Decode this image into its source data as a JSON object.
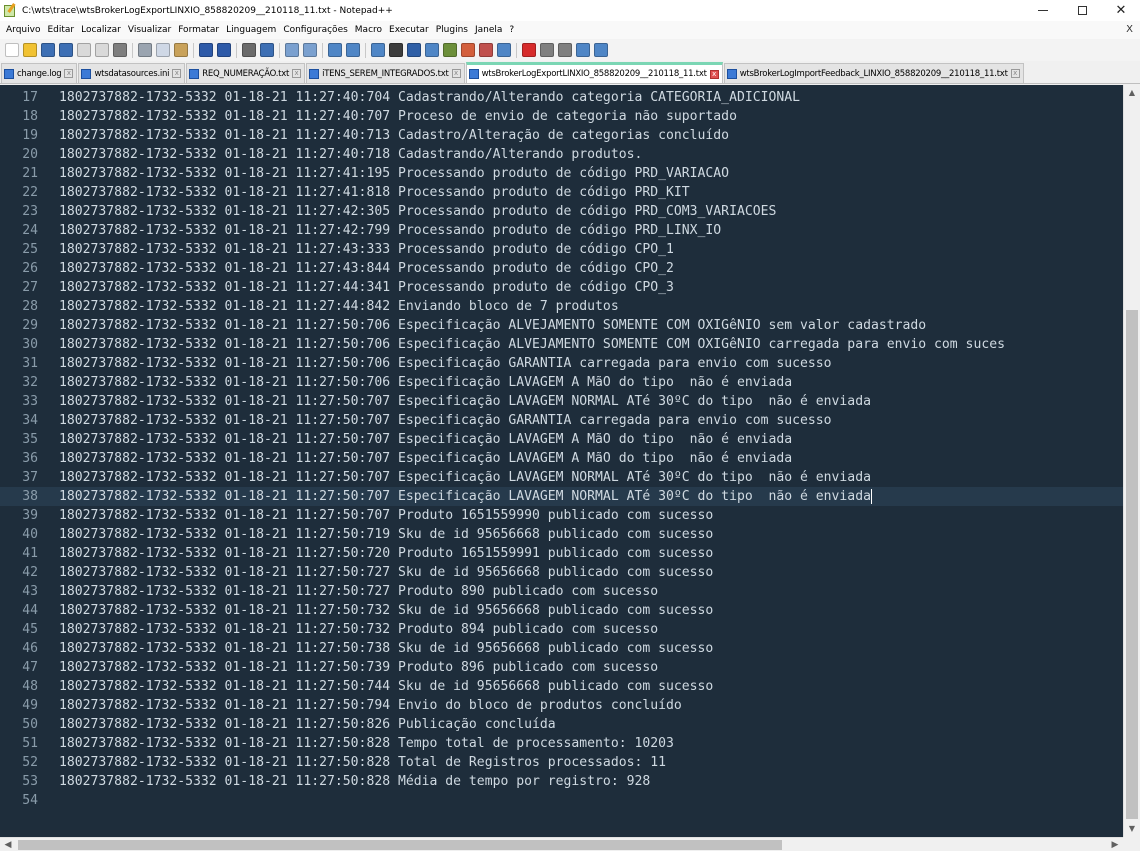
{
  "window": {
    "title": "C:\\wts\\trace\\wtsBrokerLogExportLINXIO_858820209__210118_11.txt - Notepad++",
    "controls": {
      "minimize": "—",
      "maximize": "□",
      "close": "✕"
    }
  },
  "menu": {
    "items": [
      "Arquivo",
      "Editar",
      "Localizar",
      "Visualizar",
      "Formatar",
      "Linguagem",
      "Configurações",
      "Macro",
      "Executar",
      "Plugins",
      "Janela",
      "?"
    ],
    "close_x": "X"
  },
  "toolbar": {
    "icons": [
      {
        "name": "new-file-icon",
        "color": "#ffffff"
      },
      {
        "name": "open-file-icon",
        "color": "#f1c232"
      },
      {
        "name": "save-icon",
        "color": "#3d6fb4"
      },
      {
        "name": "save-all-icon",
        "color": "#3d6fb4"
      },
      {
        "name": "close-file-icon",
        "color": "#d9d9d9"
      },
      {
        "name": "close-all-icon",
        "color": "#d9d9d9"
      },
      {
        "name": "print-icon",
        "color": "#7f7f7f"
      },
      {
        "sep": true
      },
      {
        "name": "cut-icon",
        "color": "#9aa4b0"
      },
      {
        "name": "copy-icon",
        "color": "#cfd8e6"
      },
      {
        "name": "paste-icon",
        "color": "#c9a25a"
      },
      {
        "sep": true
      },
      {
        "name": "undo-icon",
        "color": "#2e5aa8"
      },
      {
        "name": "redo-icon",
        "color": "#2e5aa8"
      },
      {
        "sep": true
      },
      {
        "name": "find-icon",
        "color": "#6a6a6a"
      },
      {
        "name": "replace-icon",
        "color": "#3d6fb4"
      },
      {
        "sep": true
      },
      {
        "name": "zoom-in-icon",
        "color": "#7aa0cf"
      },
      {
        "name": "zoom-out-icon",
        "color": "#7aa0cf"
      },
      {
        "sep": true
      },
      {
        "name": "sync-vertical-icon",
        "color": "#4f86c6"
      },
      {
        "name": "sync-horizontal-icon",
        "color": "#4f86c6"
      },
      {
        "sep": true
      },
      {
        "name": "word-wrap-icon",
        "color": "#4f86c6"
      },
      {
        "name": "show-all-chars-icon",
        "color": "#3d3d3d"
      },
      {
        "name": "indent-guide-icon",
        "color": "#2f5fa6"
      },
      {
        "name": "udl-icon",
        "color": "#4f86c6"
      },
      {
        "name": "doc-map-icon",
        "color": "#6c8f3a"
      },
      {
        "name": "function-list-icon",
        "color": "#d35f3c"
      },
      {
        "name": "folder-workspace-icon",
        "color": "#c0504d"
      },
      {
        "name": "monitoring-icon",
        "color": "#4f86c6"
      },
      {
        "sep": true
      },
      {
        "name": "record-macro-icon",
        "color": "#d62b2b"
      },
      {
        "name": "stop-macro-icon",
        "color": "#7f7f7f"
      },
      {
        "name": "play-macro-icon",
        "color": "#7f7f7f"
      },
      {
        "name": "run-macro-multiple-icon",
        "color": "#4f86c6"
      },
      {
        "name": "save-macro-icon",
        "color": "#4f86c6"
      }
    ]
  },
  "tabs": [
    {
      "label": "change.log",
      "active": false
    },
    {
      "label": "wtsdatasources.ini",
      "active": false
    },
    {
      "label": "REQ_NUMERAÇÃO.txt",
      "active": false
    },
    {
      "label": "iTENS_SEREM_INTEGRADOS.txt",
      "active": false
    },
    {
      "label": "wtsBrokerLogExportLINXIO_858820209__210118_11.txt",
      "active": true
    },
    {
      "label": "wtsBrokerLogImportFeedback_LINXIO_858820209__210118_11.txt",
      "active": false
    }
  ],
  "editor": {
    "current_line": 38,
    "lines": [
      {
        "n": "17",
        "text": "1802737882-1732-5332 01-18-21 11:27:40:704 Cadastrando/Alterando categoria CATEGORIA_ADICIONAL"
      },
      {
        "n": "18",
        "text": "1802737882-1732-5332 01-18-21 11:27:40:707 Proceso de envio de categoria não suportado"
      },
      {
        "n": "19",
        "text": "1802737882-1732-5332 01-18-21 11:27:40:713 Cadastro/Alteração de categorias concluído"
      },
      {
        "n": "20",
        "text": "1802737882-1732-5332 01-18-21 11:27:40:718 Cadastrando/Alterando produtos."
      },
      {
        "n": "21",
        "text": "1802737882-1732-5332 01-18-21 11:27:41:195 Processando produto de código PRD_VARIACAO"
      },
      {
        "n": "22",
        "text": "1802737882-1732-5332 01-18-21 11:27:41:818 Processando produto de código PRD_KIT"
      },
      {
        "n": "23",
        "text": "1802737882-1732-5332 01-18-21 11:27:42:305 Processando produto de código PRD_COM3_VARIACOES"
      },
      {
        "n": "24",
        "text": "1802737882-1732-5332 01-18-21 11:27:42:799 Processando produto de código PRD_LINX_IO"
      },
      {
        "n": "25",
        "text": "1802737882-1732-5332 01-18-21 11:27:43:333 Processando produto de código CPO_1"
      },
      {
        "n": "26",
        "text": "1802737882-1732-5332 01-18-21 11:27:43:844 Processando produto de código CPO_2"
      },
      {
        "n": "27",
        "text": "1802737882-1732-5332 01-18-21 11:27:44:341 Processando produto de código CPO_3"
      },
      {
        "n": "28",
        "text": "1802737882-1732-5332 01-18-21 11:27:44:842 Enviando bloco de 7 produtos"
      },
      {
        "n": "29",
        "text": "1802737882-1732-5332 01-18-21 11:27:50:706 Especificação ALVEJAMENTO SOMENTE COM OXIGêNIO sem valor cadastrado"
      },
      {
        "n": "30",
        "text": "1802737882-1732-5332 01-18-21 11:27:50:706 Especificação ALVEJAMENTO SOMENTE COM OXIGêNIO carregada para envio com suces"
      },
      {
        "n": "31",
        "text": "1802737882-1732-5332 01-18-21 11:27:50:706 Especificação GARANTIA carregada para envio com sucesso"
      },
      {
        "n": "32",
        "text": "1802737882-1732-5332 01-18-21 11:27:50:706 Especificação LAVAGEM A MãO do tipo  não é enviada"
      },
      {
        "n": "33",
        "text": "1802737882-1732-5332 01-18-21 11:27:50:707 Especificação LAVAGEM NORMAL ATé 30ºC do tipo  não é enviada"
      },
      {
        "n": "34",
        "text": "1802737882-1732-5332 01-18-21 11:27:50:707 Especificação GARANTIA carregada para envio com sucesso"
      },
      {
        "n": "35",
        "text": "1802737882-1732-5332 01-18-21 11:27:50:707 Especificação LAVAGEM A MãO do tipo  não é enviada"
      },
      {
        "n": "36",
        "text": "1802737882-1732-5332 01-18-21 11:27:50:707 Especificação LAVAGEM A MãO do tipo  não é enviada"
      },
      {
        "n": "37",
        "text": "1802737882-1732-5332 01-18-21 11:27:50:707 Especificação LAVAGEM NORMAL ATé 30ºC do tipo  não é enviada"
      },
      {
        "n": "38",
        "text": "1802737882-1732-5332 01-18-21 11:27:50:707 Especificação LAVAGEM NORMAL ATé 30ºC do tipo  não é enviada"
      },
      {
        "n": "39",
        "text": "1802737882-1732-5332 01-18-21 11:27:50:707 Produto 1651559990 publicado com sucesso"
      },
      {
        "n": "40",
        "text": "1802737882-1732-5332 01-18-21 11:27:50:719 Sku de id 95656668 publicado com sucesso"
      },
      {
        "n": "41",
        "text": "1802737882-1732-5332 01-18-21 11:27:50:720 Produto 1651559991 publicado com sucesso"
      },
      {
        "n": "42",
        "text": "1802737882-1732-5332 01-18-21 11:27:50:727 Sku de id 95656668 publicado com sucesso"
      },
      {
        "n": "43",
        "text": "1802737882-1732-5332 01-18-21 11:27:50:727 Produto 890 publicado com sucesso"
      },
      {
        "n": "44",
        "text": "1802737882-1732-5332 01-18-21 11:27:50:732 Sku de id 95656668 publicado com sucesso"
      },
      {
        "n": "45",
        "text": "1802737882-1732-5332 01-18-21 11:27:50:732 Produto 894 publicado com sucesso"
      },
      {
        "n": "46",
        "text": "1802737882-1732-5332 01-18-21 11:27:50:738 Sku de id 95656668 publicado com sucesso"
      },
      {
        "n": "47",
        "text": "1802737882-1732-5332 01-18-21 11:27:50:739 Produto 896 publicado com sucesso"
      },
      {
        "n": "48",
        "text": "1802737882-1732-5332 01-18-21 11:27:50:744 Sku de id 95656668 publicado com sucesso"
      },
      {
        "n": "49",
        "text": "1802737882-1732-5332 01-18-21 11:27:50:794 Envio do bloco de produtos concluído"
      },
      {
        "n": "50",
        "text": "1802737882-1732-5332 01-18-21 11:27:50:826 Publicação concluída"
      },
      {
        "n": "51",
        "text": "1802737882-1732-5332 01-18-21 11:27:50:828 Tempo total de processamento: 10203"
      },
      {
        "n": "52",
        "text": "1802737882-1732-5332 01-18-21 11:27:50:828 Total de Registros processados: 11"
      },
      {
        "n": "53",
        "text": "1802737882-1732-5332 01-18-21 11:27:50:828 Média de tempo por registro: 928"
      },
      {
        "n": "54",
        "text": ""
      }
    ]
  },
  "scrollbars": {
    "vertical": {
      "up": "▲",
      "down": "▼"
    },
    "horizontal": {
      "left": "◀",
      "right": "▶"
    }
  },
  "colors": {
    "editor_bg": "#1e2d3b",
    "editor_fg": "#cfd9e1",
    "line_number_fg": "#8a9caa",
    "current_line_bg": "#263a4c",
    "active_tab_accent": "#7bd6b4"
  }
}
